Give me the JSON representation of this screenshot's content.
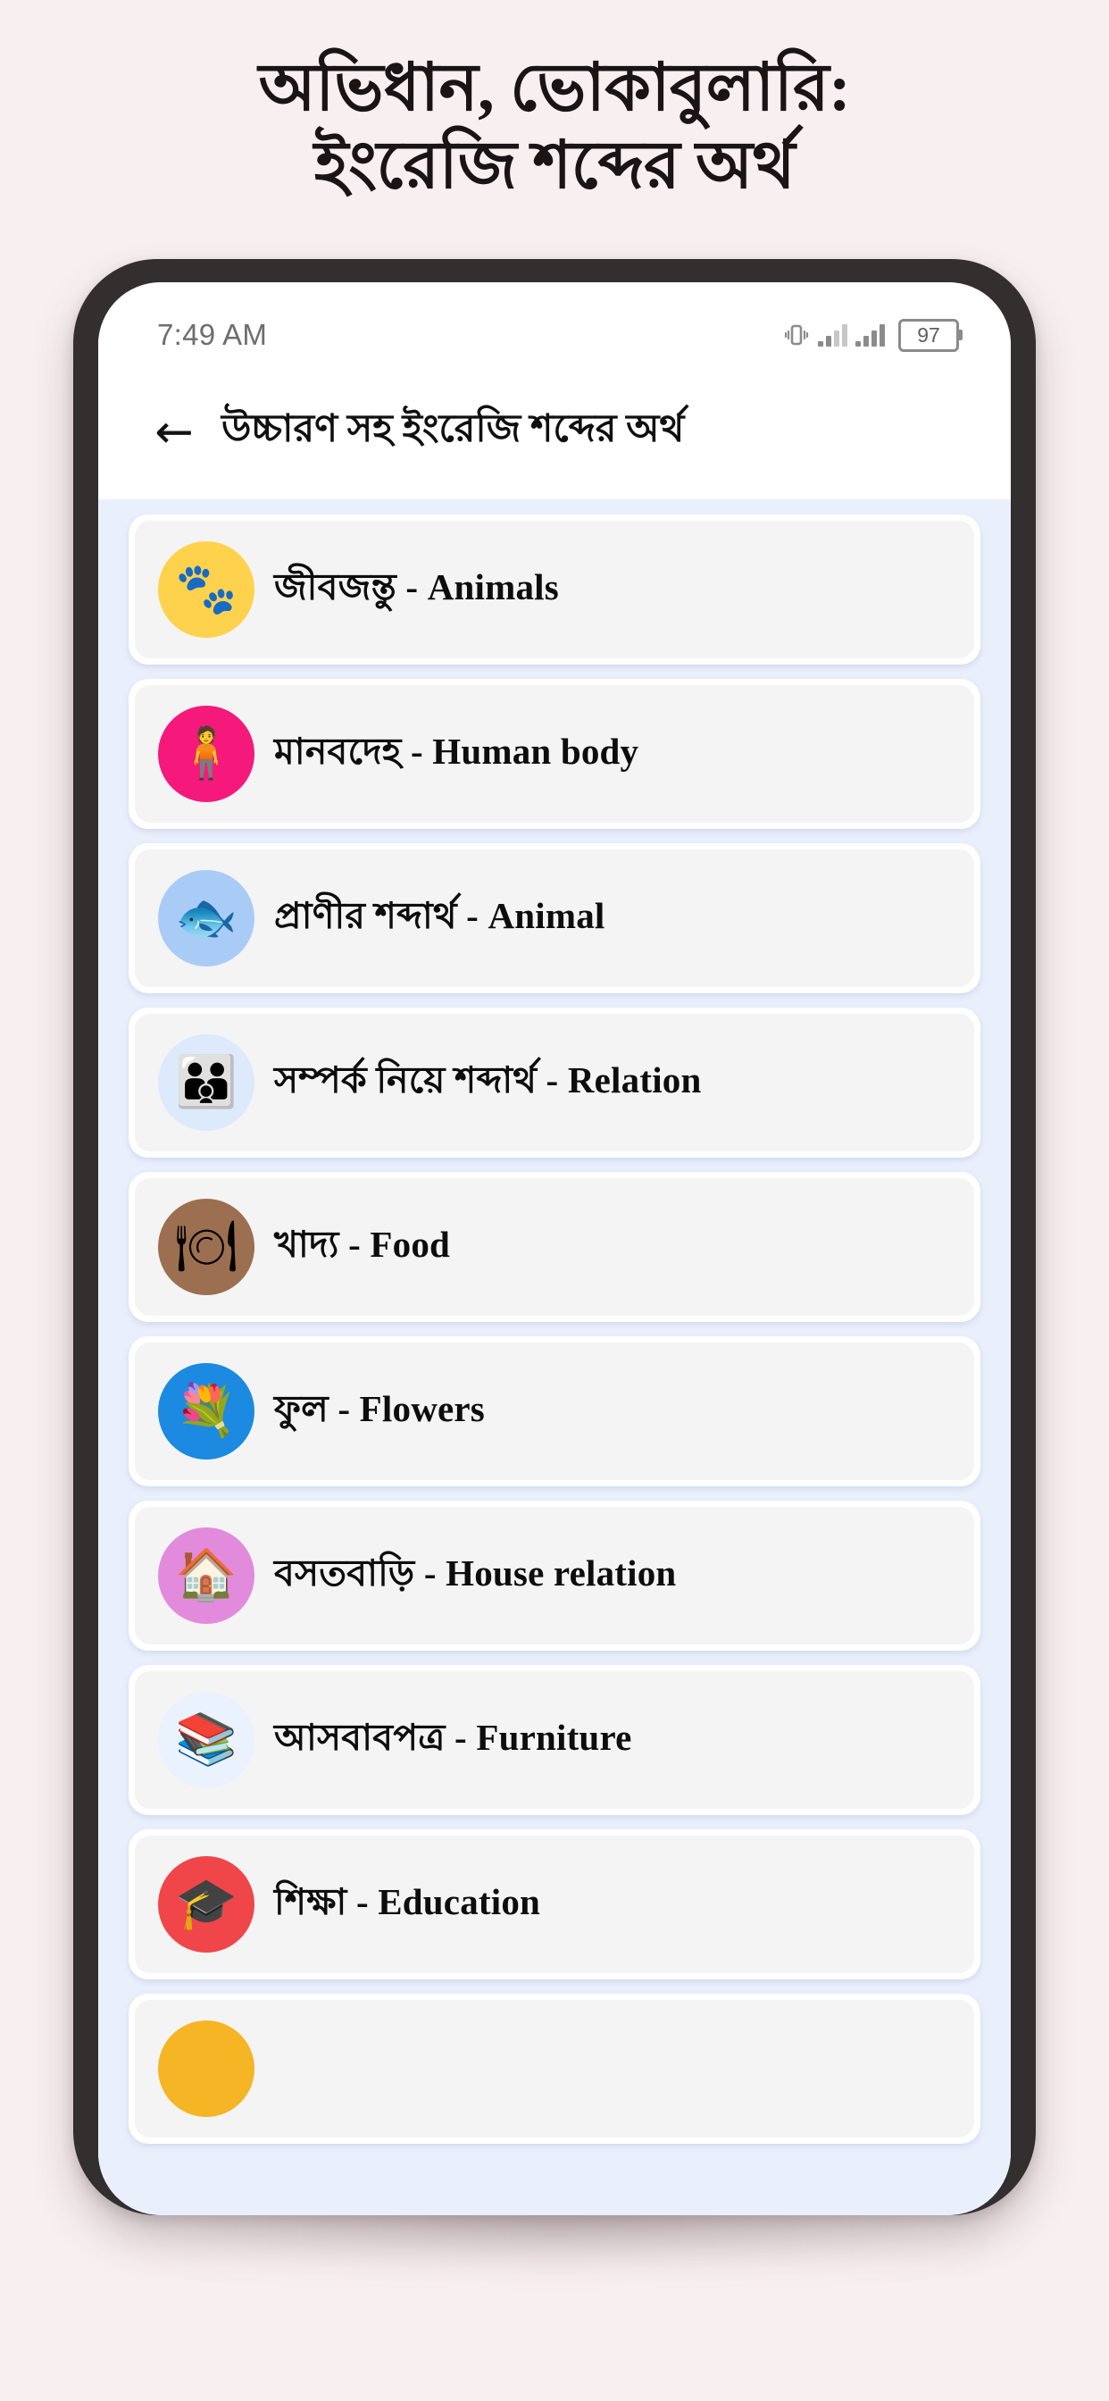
{
  "promo": {
    "headline_line1": "অভিধান, ভোকাবুলারি:",
    "headline_line2": "ইংরেজি শব্দের অর্থ"
  },
  "status_bar": {
    "time": "7:49 AM",
    "battery_level": "97",
    "icons": [
      "vibrate-icon",
      "signal-bars-icon",
      "signal-bars-icon",
      "battery-icon"
    ]
  },
  "app_bar": {
    "back_label": "←",
    "title": "উচ্চারণ সহ ইংরেজি শব্দের অর্থ"
  },
  "colors": {
    "promo_background": "#f7eff0",
    "phone_frame": "#332f2e",
    "list_background": "#eaeffc",
    "card_outer": "#ffffff",
    "card_inner": "#f4f4f4",
    "app_bar_background": "#ffffff",
    "title_text": "#101010",
    "status_text": "#6e6e6e"
  },
  "category_list": {
    "items": [
      {
        "label": "জীবজন্তু - Animals",
        "bengali": "জীবজন্তু",
        "english": "Animals",
        "icon_name": "heart-paw-icon",
        "icon_glyph": "🐾",
        "icon_bg": "#ffd24d",
        "icon_fg": "#f4444f"
      },
      {
        "label": "মানবদেহ - Human body",
        "bengali": "মানবদেহ",
        "english": "Human body",
        "icon_name": "human-body-icon",
        "icon_glyph": "🧍",
        "icon_bg": "#f5197c",
        "icon_fg": "#fcd6bd"
      },
      {
        "label": "প্রাণীর শব্দার্থ - Animal",
        "bengali": "প্রাণীর শব্দার্থ",
        "english": "Animal",
        "icon_name": "fish-icon",
        "icon_glyph": "🐟",
        "icon_bg": "#a9ccf7",
        "icon_fg": "#ffc42e"
      },
      {
        "label": "সম্পর্ক নিয়ে শব্দার্থ - Relation",
        "bengali": "সম্পর্ক নিয়ে শব্দার্থ",
        "english": "Relation",
        "icon_name": "family-group-icon",
        "icon_glyph": "👪",
        "icon_bg": "#dceafb",
        "icon_fg": "#f07b51"
      },
      {
        "label": "খাদ্য - Food",
        "bengali": "খাদ্য",
        "english": "Food",
        "icon_name": "food-plate-icon",
        "icon_glyph": "🍽",
        "icon_bg": "#9b6f4f",
        "icon_fg": "#8ec9e8"
      },
      {
        "label": "ফুল - Flowers",
        "bengali": "ফুল",
        "english": "Flowers",
        "icon_name": "flower-basket-icon",
        "icon_glyph": "💐",
        "icon_bg": "#1b8ae0",
        "icon_fg": "#f5a623"
      },
      {
        "label": "বসতবাড়ি - House relation",
        "bengali": "বসতবাড়ি",
        "english": "House relation",
        "icon_name": "house-shield-icon",
        "icon_glyph": "🏠",
        "icon_bg": "#e28bdd",
        "icon_fg": "#b4521f"
      },
      {
        "label": "আসবাবপত্র - Furniture",
        "bengali": "আসবাবপত্র",
        "english": "Furniture",
        "icon_name": "plant-books-icon",
        "icon_glyph": "📚",
        "icon_bg": "#eaf2fd",
        "icon_fg": "#2f56e0"
      },
      {
        "label": "শিক্ষা - Education",
        "bengali": "শিক্ষা",
        "english": "Education",
        "icon_name": "globe-graduation-cap-icon",
        "icon_glyph": "🎓",
        "icon_bg": "#f0464a",
        "icon_fg": "#3aa3e0"
      },
      {
        "label": "",
        "bengali": "",
        "english": "",
        "icon_name": "partial-yellow-icon",
        "icon_glyph": "",
        "icon_bg": "#f5b524",
        "icon_fg": "#f5b524"
      }
    ]
  }
}
